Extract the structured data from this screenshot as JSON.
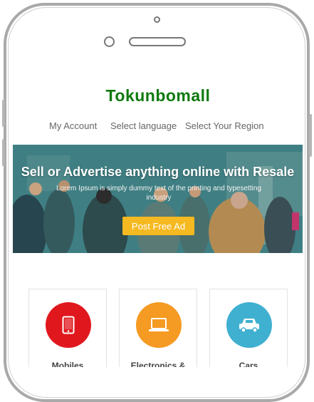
{
  "header": {
    "brand": "Tokunbomall"
  },
  "nav": {
    "items": [
      {
        "label": "My Account"
      },
      {
        "label": "Select language"
      },
      {
        "label": "Select Your Region"
      }
    ]
  },
  "banner": {
    "title": "Sell or Advertise anything online with Resale",
    "subtitle": "Lorem Ipsum is simply dummy text of the printing and typesetting industry",
    "button_label": "Post Free Ad"
  },
  "categories": [
    {
      "label": "Mobiles",
      "icon": "mobile-icon",
      "color": "#e0181e"
    },
    {
      "label": "Electronics &",
      "icon": "laptop-icon",
      "color": "#f59a22"
    },
    {
      "label": "Cars",
      "icon": "car-icon",
      "color": "#3fb0d0"
    }
  ],
  "colors": {
    "brand": "#0f7a0f",
    "button": "#f5b921"
  }
}
